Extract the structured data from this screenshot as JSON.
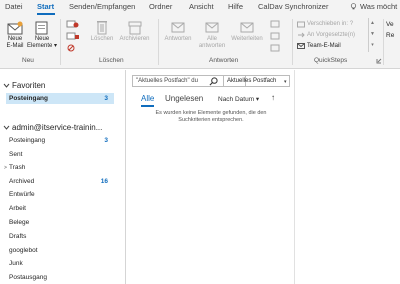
{
  "tabs": [
    {
      "label": "Datei"
    },
    {
      "label": "Start"
    },
    {
      "label": "Senden/Empfangen"
    },
    {
      "label": "Ordner"
    },
    {
      "label": "Ansicht"
    },
    {
      "label": "Hilfe"
    },
    {
      "label": "CalDav Synchronizer"
    }
  ],
  "tell_me": "Was möcht",
  "ribbon": {
    "groups": {
      "neu": "Neu",
      "loeschen": "Löschen",
      "antworten": "Antworten",
      "quicksteps": "QuickSteps"
    },
    "buttons": {
      "new_email": [
        "Neue",
        "E-Mail"
      ],
      "new_items": [
        "Neue",
        "Elemente"
      ],
      "delete": "Löschen",
      "archive": "Archivieren",
      "reply": "Antworten",
      "reply_all": [
        "Alle",
        "antworten"
      ],
      "forward": "Weiterleiten"
    },
    "quicksteps": [
      {
        "label": "Verschieben in: ?",
        "enabled": false
      },
      {
        "label": "An Vorgesetzte(n)",
        "enabled": false
      },
      {
        "label": "Team-E-Mail",
        "enabled": true
      }
    ],
    "clipped_right": [
      "Ve",
      "Re"
    ]
  },
  "folders": {
    "favorites_title": "Favoriten",
    "favorites": [
      {
        "name": "Posteingang",
        "count": "3"
      }
    ],
    "account_title": "admin@itservice-trainin...",
    "items": [
      {
        "name": "Posteingang",
        "count": "3"
      },
      {
        "name": "Sent",
        "count": ""
      },
      {
        "name": "Trash",
        "count": ""
      },
      {
        "name": "Archived",
        "count": "16"
      },
      {
        "name": "Entwürfe",
        "count": ""
      },
      {
        "name": "Arbeit",
        "count": ""
      },
      {
        "name": "Belege",
        "count": ""
      },
      {
        "name": "Drafts",
        "count": ""
      },
      {
        "name": "googlebot",
        "count": ""
      },
      {
        "name": "Junk",
        "count": ""
      },
      {
        "name": "Postausgang",
        "count": ""
      }
    ]
  },
  "list": {
    "search_placeholder": "\"Aktuelles Postfach\" du",
    "scope": "Aktuelles Postfach",
    "filters": {
      "all": "Alle",
      "unread": "Ungelesen"
    },
    "sort": "Nach Datum",
    "sort_arrow": "↑",
    "empty_line1": "Es wurden keine Elemente gefunden, die den",
    "empty_line2": "Suchkriterien entsprechen."
  },
  "colors": {
    "accent": "#0f6cbd",
    "selection": "#cde6f7",
    "ribbon_bg": "#f3f3f3"
  }
}
